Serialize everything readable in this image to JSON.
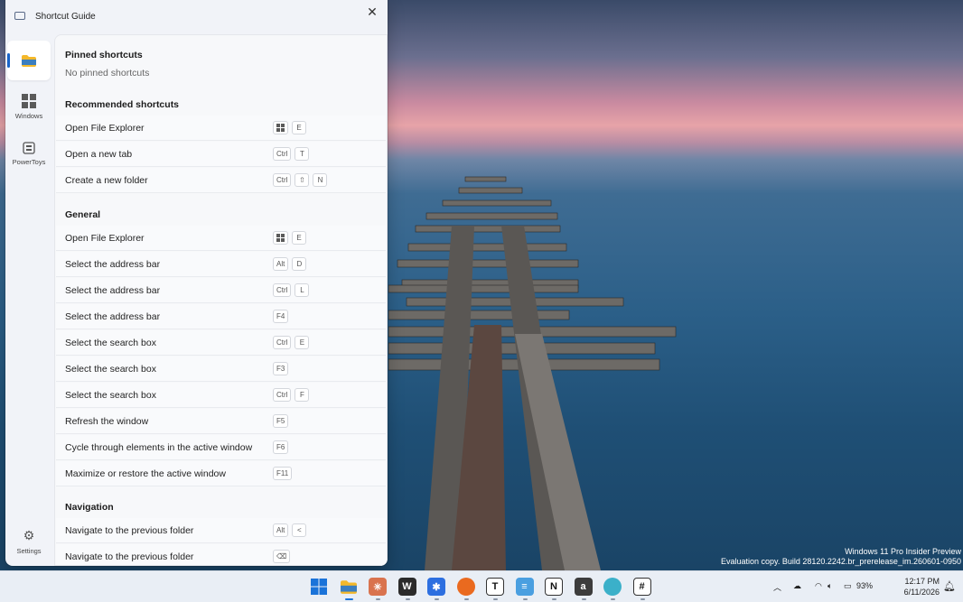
{
  "window": {
    "title": "Shortcut Guide",
    "close_icon": "close-icon"
  },
  "nav": {
    "items": [
      {
        "name": "file-explorer",
        "label": "",
        "icon": "folder-icon",
        "selected": true
      },
      {
        "name": "windows",
        "label": "Windows",
        "icon": "windows-logo-icon",
        "selected": false
      },
      {
        "name": "powertoys",
        "label": "PowerToys",
        "icon": "powertoys-icon",
        "selected": false
      }
    ],
    "settings_label": "Settings"
  },
  "pinned": {
    "title": "Pinned shortcuts",
    "empty_text": "No pinned shortcuts"
  },
  "recommended": {
    "title": "Recommended shortcuts",
    "rows": [
      {
        "label": "Open File Explorer",
        "keys": [
          "WIN",
          "E"
        ]
      },
      {
        "label": "Open a new tab",
        "keys": [
          "Ctrl",
          "T"
        ]
      },
      {
        "label": "Create a new folder",
        "keys": [
          "Ctrl",
          "⇧",
          "N"
        ]
      }
    ]
  },
  "general": {
    "title": "General",
    "rows": [
      {
        "label": "Open File Explorer",
        "keys": [
          "WIN",
          "E"
        ]
      },
      {
        "label": "Select the address bar",
        "keys": [
          "Alt",
          "D"
        ]
      },
      {
        "label": "Select the address bar",
        "keys": [
          "Ctrl",
          "L"
        ]
      },
      {
        "label": "Select the address bar",
        "keys": [
          "F4"
        ]
      },
      {
        "label": "Select the search box",
        "keys": [
          "Ctrl",
          "E"
        ]
      },
      {
        "label": "Select the search box",
        "keys": [
          "F3"
        ]
      },
      {
        "label": "Select the search box",
        "keys": [
          "Ctrl",
          "F"
        ]
      },
      {
        "label": "Refresh the window",
        "keys": [
          "F5"
        ]
      },
      {
        "label": "Cycle through elements in the active window",
        "keys": [
          "F6"
        ]
      },
      {
        "label": "Maximize or restore the active window",
        "keys": [
          "F11"
        ]
      }
    ]
  },
  "navigation": {
    "title": "Navigation",
    "rows": [
      {
        "label": "Navigate to the previous folder",
        "keys": [
          "Alt",
          "<"
        ]
      },
      {
        "label": "Navigate to the previous folder",
        "keys": [
          "⌫"
        ]
      }
    ]
  },
  "desktop": {
    "watermark_line1": "Windows 11 Pro Insider Preview",
    "watermark_line2": "Evaluation copy. Build 28120.2242.br_prerelease_im.260601-0950"
  },
  "taskbar": {
    "apps": [
      {
        "name": "start",
        "icon": "windows-start-icon",
        "glyph": "",
        "color": "#1a73d9"
      },
      {
        "name": "file-explorer",
        "icon": "folder-icon",
        "glyph": "",
        "color": "#f3b82b"
      },
      {
        "name": "claude",
        "icon": "starburst-icon",
        "glyph": "✳",
        "color": "#d9734e"
      },
      {
        "name": "app-w",
        "icon": "w-badge-icon",
        "glyph": "W",
        "color": "#2b2b2b"
      },
      {
        "name": "bluesky",
        "icon": "asterisk-icon",
        "glyph": "✱",
        "color": "#2d6fe0"
      },
      {
        "name": "firefox",
        "icon": "firefox-icon",
        "glyph": "",
        "color": "#ea6a1f"
      },
      {
        "name": "typora",
        "icon": "t-letter-icon",
        "glyph": "T",
        "color": "#ffffff"
      },
      {
        "name": "notepad",
        "icon": "notepad-icon",
        "glyph": "≡",
        "color": "#4a9fe0"
      },
      {
        "name": "notion",
        "icon": "notion-icon",
        "glyph": "N",
        "color": "#ffffff"
      },
      {
        "name": "app-a",
        "icon": "a-letter-icon",
        "glyph": "a",
        "color": "#3c3c3c"
      },
      {
        "name": "edge-beta",
        "icon": "browser-icon",
        "glyph": "",
        "color": "#3bb0c9"
      },
      {
        "name": "slack",
        "icon": "slack-icon",
        "glyph": "#",
        "color": "#ffffff"
      }
    ],
    "battery_percent": "93%",
    "time": "12:17 PM",
    "date": "6/11/2026"
  }
}
